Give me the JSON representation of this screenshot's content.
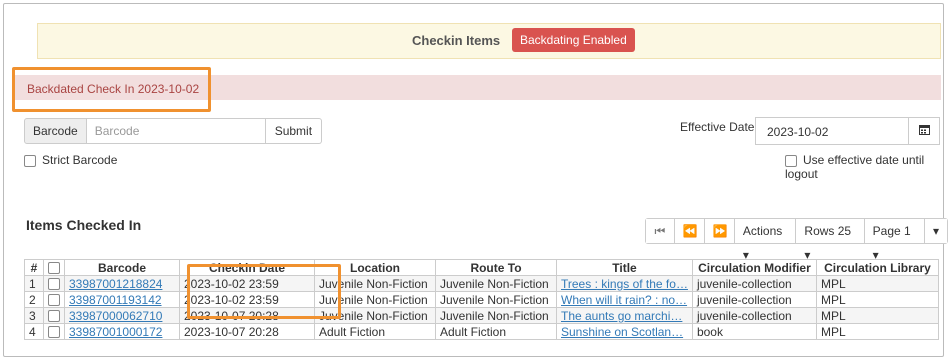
{
  "header": {
    "title": "Checkin Items",
    "badge": "Backdating Enabled"
  },
  "alert": {
    "text": "Backdated Check In 2023-10-02"
  },
  "barcode": {
    "addon_label": "Barcode",
    "placeholder": "Barcode",
    "submit_label": "Submit",
    "strict_label": "Strict Barcode"
  },
  "effective": {
    "label": "Effective Date",
    "value": "2023-10-02",
    "use_until_logout_label": "Use effective date until logout"
  },
  "items": {
    "title": "Items Checked In",
    "actions_label": "Actions ▾",
    "rows_label": "Rows 25 ▾",
    "page_label": "Page 1 ▾",
    "more_label": "▾",
    "columns": [
      "#",
      "",
      "Barcode",
      "Checkin Date",
      "Location",
      "Route To",
      "Title",
      "Circulation Modifier",
      "Circulation Library"
    ],
    "rows": [
      [
        "1",
        "",
        "33987001218824",
        "2023-10-02 23:59",
        "Juvenile Non-Fiction",
        "Juvenile Non-Fiction",
        "Trees : kings of the fo…",
        "juvenile-collection",
        "MPL"
      ],
      [
        "2",
        "",
        "33987001193142",
        "2023-10-02 23:59",
        "Juvenile Non-Fiction",
        "Juvenile Non-Fiction",
        "When will it rain? : no…",
        "juvenile-collection",
        "MPL"
      ],
      [
        "3",
        "",
        "33987000062710",
        "2023-10-07 20:28",
        "Juvenile Non-Fiction",
        "Juvenile Non-Fiction",
        "The aunts go marchi…",
        "juvenile-collection",
        "MPL"
      ],
      [
        "4",
        "",
        "33987001000172",
        "2023-10-07 20:28",
        "Adult Fiction",
        "Adult Fiction",
        "Sunshine on Scotlan…",
        "book",
        "MPL"
      ]
    ]
  }
}
